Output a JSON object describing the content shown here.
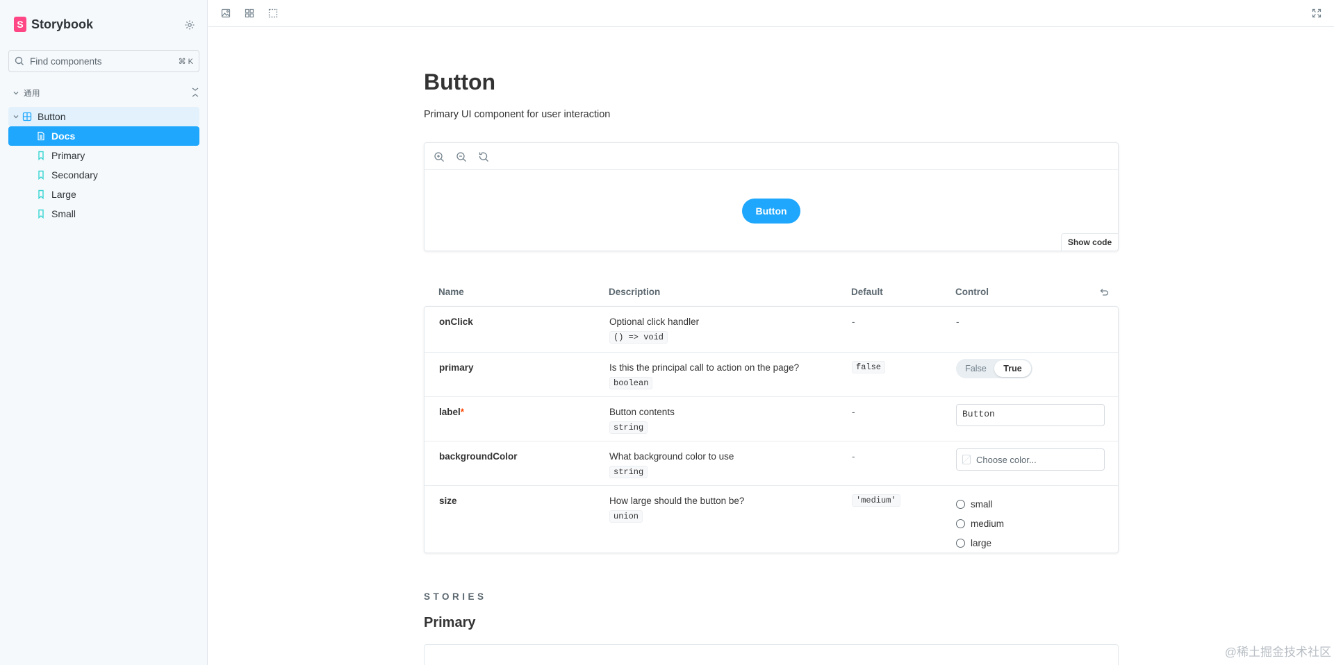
{
  "sidebar": {
    "brand": "Storybook",
    "search": {
      "placeholder": "Find components",
      "shortcut": "⌘ K"
    },
    "group": "通用",
    "component": "Button",
    "items": [
      {
        "label": "Docs",
        "type": "docs",
        "selected": true
      },
      {
        "label": "Primary",
        "type": "story"
      },
      {
        "label": "Secondary",
        "type": "story"
      },
      {
        "label": "Large",
        "type": "story"
      },
      {
        "label": "Small",
        "type": "story"
      }
    ]
  },
  "docs": {
    "title": "Button",
    "subtitle": "Primary UI component for user interaction",
    "preview": {
      "button_label": "Button",
      "show_code": "Show code"
    },
    "args_table": {
      "columns": [
        "Name",
        "Description",
        "Default",
        "Control"
      ],
      "rows": [
        {
          "name": "onClick",
          "required": false,
          "description": "Optional click handler",
          "type": "() => void",
          "default": "-",
          "control": "-"
        },
        {
          "name": "primary",
          "required": false,
          "description": "Is this the principal call to action on the page?",
          "type": "boolean",
          "default": "false",
          "control": {
            "false_label": "False",
            "true_label": "True",
            "value": true
          }
        },
        {
          "name": "label",
          "required": true,
          "required_mark": "*",
          "description": "Button contents",
          "type": "string",
          "default": "-",
          "control": "Button"
        },
        {
          "name": "backgroundColor",
          "required": false,
          "description": "What background color to use",
          "type": "string",
          "default": "-",
          "control": {
            "placeholder": "Choose color..."
          }
        },
        {
          "name": "size",
          "required": false,
          "description": "How large should the button be?",
          "type": "union",
          "default": "'medium'",
          "control": {
            "options": [
              "small",
              "medium",
              "large"
            ]
          }
        }
      ]
    },
    "stories_heading": "STORIES",
    "first_story_title": "Primary"
  },
  "watermark": "@稀土掘金技术社区",
  "colors": {
    "accent": "#1ea7fd",
    "brand": "#ff4785",
    "sidebar_bg": "#f6f9fc",
    "required": "#ff4400"
  }
}
